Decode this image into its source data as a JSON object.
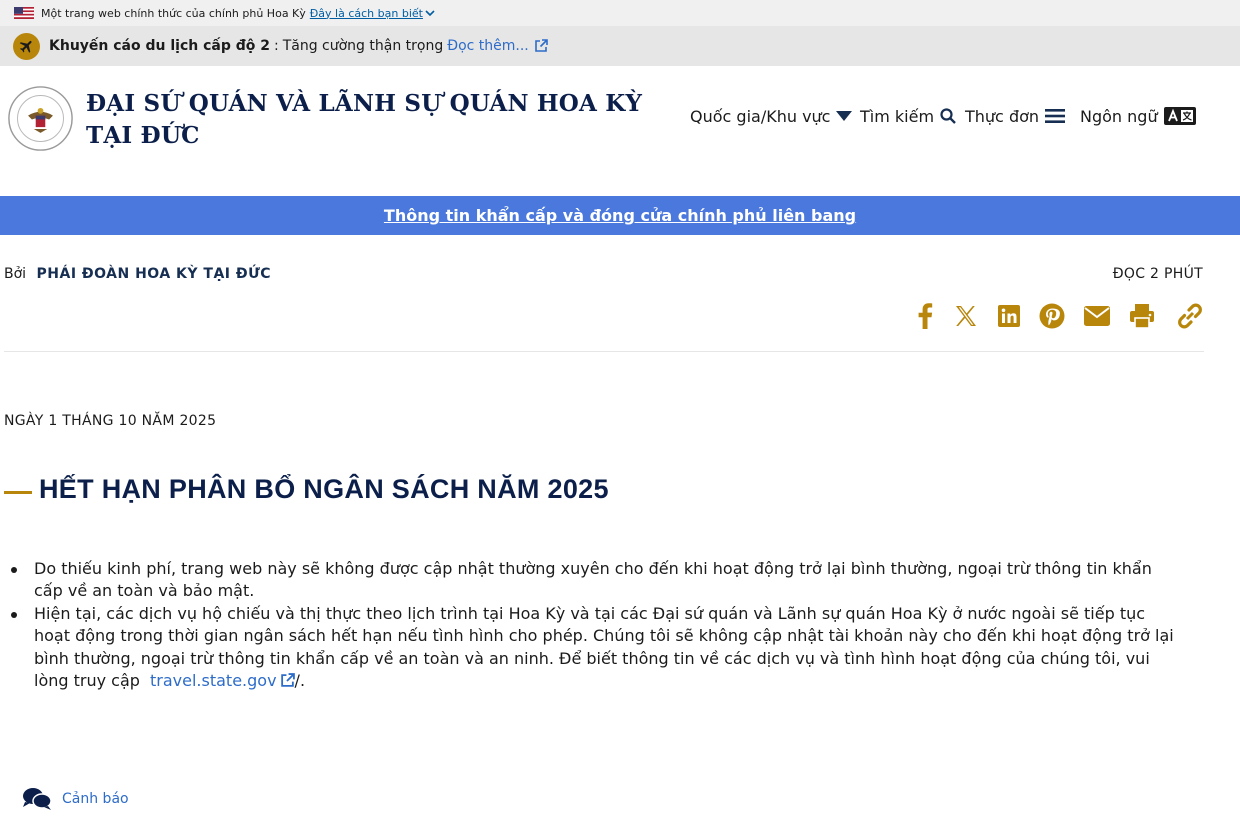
{
  "gov_banner": {
    "text": "Một trang web chính thức của chính phủ Hoa Kỳ",
    "link": "Đây là cách bạn biết"
  },
  "advisory": {
    "level": "Khuyến cáo du lịch cấp độ 2",
    "separator": ":",
    "message": "Tăng cường thận trọng",
    "more": "Đọc thêm..."
  },
  "header": {
    "title_line1": "ĐẠI SỨ QUÁN VÀ LÃNH SỰ QUÁN HOA KỲ",
    "title_line2": "TẠI ĐỨC",
    "nav": {
      "country": "Quốc gia/Khu vực",
      "search": "Tìm kiếm",
      "menu": "Thực đơn",
      "language": "Ngôn ngữ"
    }
  },
  "alert_bar": {
    "text": "Thông tin khẩn cấp và đóng cửa chính phủ liên bang"
  },
  "article": {
    "by_label": "Bởi",
    "author": "PHÁI ĐOÀN HOA KỲ TẠI ĐỨC",
    "read_time": "ĐỌC 2 PHÚT",
    "date": "NGÀY 1 THÁNG 10 NĂM 2025",
    "title": "HẾT HẠN PHÂN BỔ NGÂN SÁCH NĂM 2025",
    "bullets": [
      "Do thiếu kinh phí, trang web này sẽ không được cập nhật thường xuyên cho đến khi hoạt động trở lại bình thường, ngoại trừ thông tin khẩn cấp về an toàn và bảo mật.",
      "Hiện tại, các dịch vụ hộ chiếu và thị thực theo lịch trình tại Hoa Kỳ và tại các Đại sứ quán và Lãnh sự quán Hoa Kỳ ở nước ngoài sẽ tiếp tục hoạt động trong thời gian ngân sách hết hạn nếu tình hình cho phép. Chúng tôi sẽ không cập nhật tài khoản này cho đến khi hoạt động trở lại bình thường, ngoại trừ thông tin khẩn cấp về an toàn và an ninh. Để biết thông tin về các dịch vụ và tình hình hoạt động của chúng tôi, vui lòng truy cập"
    ],
    "link_text": "travel.state.gov",
    "link_suffix": "/."
  },
  "alerts_widget": {
    "label": "Cảnh báo"
  },
  "colors": {
    "accent_gold": "#b8860b",
    "navy": "#0b1f4a",
    "link_blue": "#2e6cc9",
    "alert_bar_blue": "#4a78dc"
  }
}
